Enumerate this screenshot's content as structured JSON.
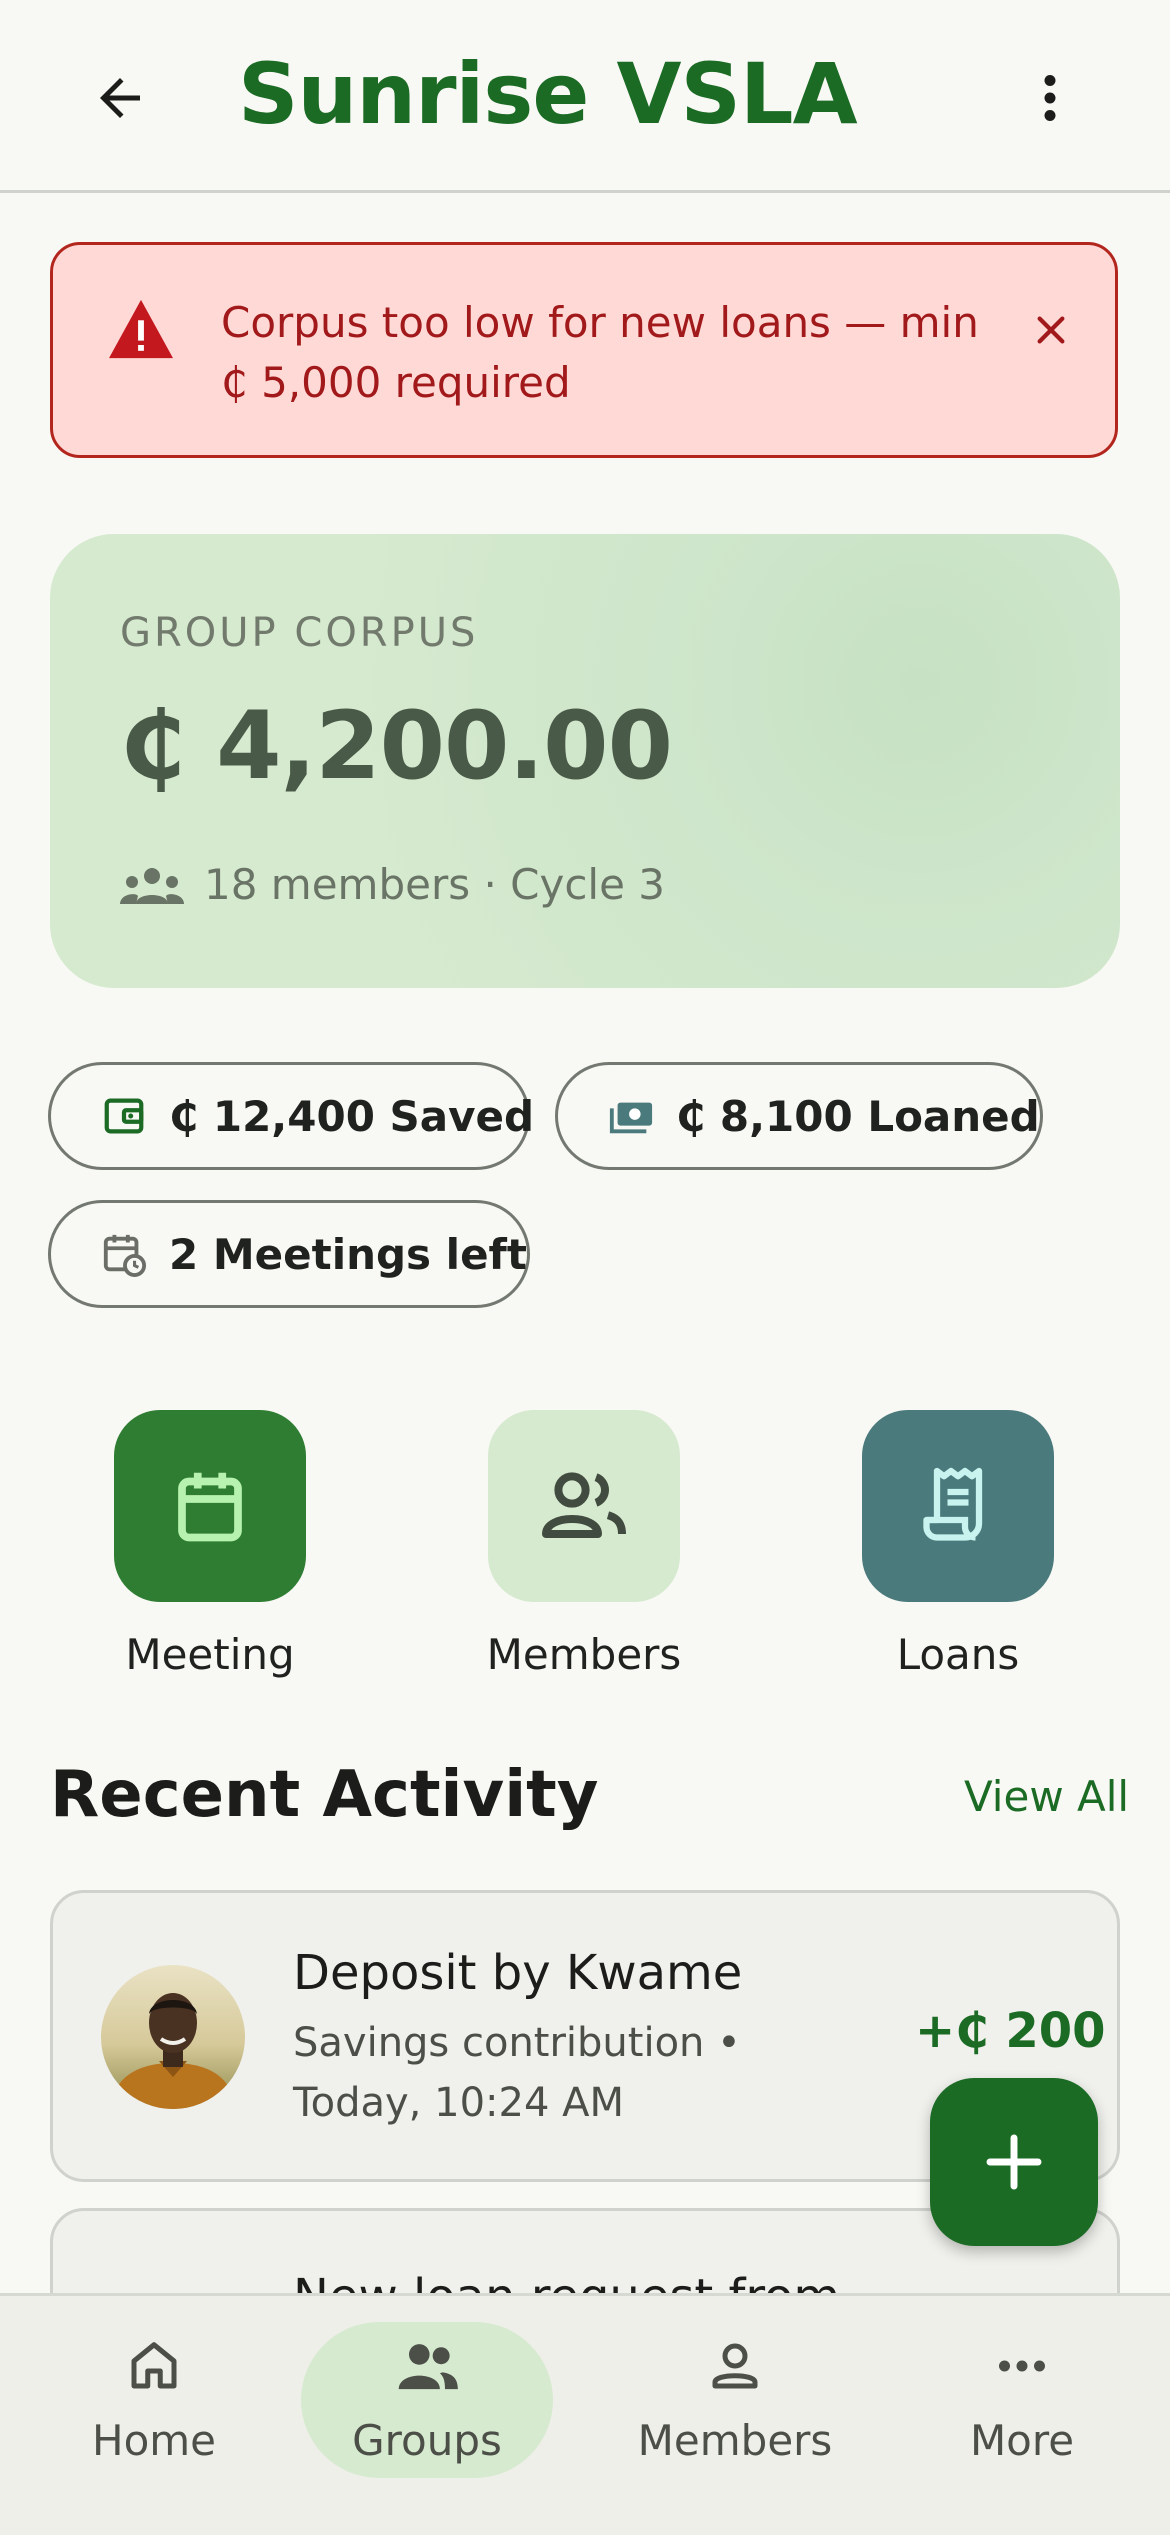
{
  "app_bar": {
    "title": "Sunrise VSLA",
    "back_icon": "arrow-left-icon",
    "menu_icon": "more-vertical-icon"
  },
  "alert": {
    "text": "Corpus too low for new loans — min ₵ 5,000 required",
    "icon": "warning-icon",
    "close_icon": "close-icon"
  },
  "corpus": {
    "label": "GROUP CORPUS",
    "amount": "₵ 4,200.00",
    "subtitle": "18 members · Cycle 3",
    "subtitle_icon": "group-icon"
  },
  "chips": [
    {
      "label": "₵ 12,400 Saved",
      "icon": "wallet-icon"
    },
    {
      "label": "₵ 8,100 Loaned",
      "icon": "cash-icon"
    },
    {
      "label": "2 Meetings left",
      "icon": "calendar-clock-icon"
    }
  ],
  "quick_actions": [
    {
      "label": "Meeting",
      "icon": "calendar-icon"
    },
    {
      "label": "Members",
      "icon": "people-icon"
    },
    {
      "label": "Loans",
      "icon": "receipt-icon"
    }
  ],
  "recent_activity": {
    "title": "Recent Activity",
    "view_all": "View All",
    "items": [
      {
        "title": "Deposit by Kwame",
        "subtitle": "Savings contribution • Today, 10:24 AM",
        "amount": "+₵ 200"
      },
      {
        "title": "New loan request from"
      }
    ]
  },
  "fab": {
    "icon": "plus-icon"
  },
  "bottom_nav": {
    "active": "Groups",
    "items": [
      {
        "label": "Home",
        "icon": "home-icon"
      },
      {
        "label": "Groups",
        "icon": "groups-icon"
      },
      {
        "label": "Members",
        "icon": "person-icon"
      },
      {
        "label": "More",
        "icon": "more-horizontal-icon"
      }
    ]
  },
  "colors": {
    "brand_green": "#1b6b25",
    "alert_red": "#b3261e",
    "alert_bg": "#ffd9d6",
    "corpus_bg": "#d6eacf",
    "loans_tile": "#4a7a7c"
  }
}
